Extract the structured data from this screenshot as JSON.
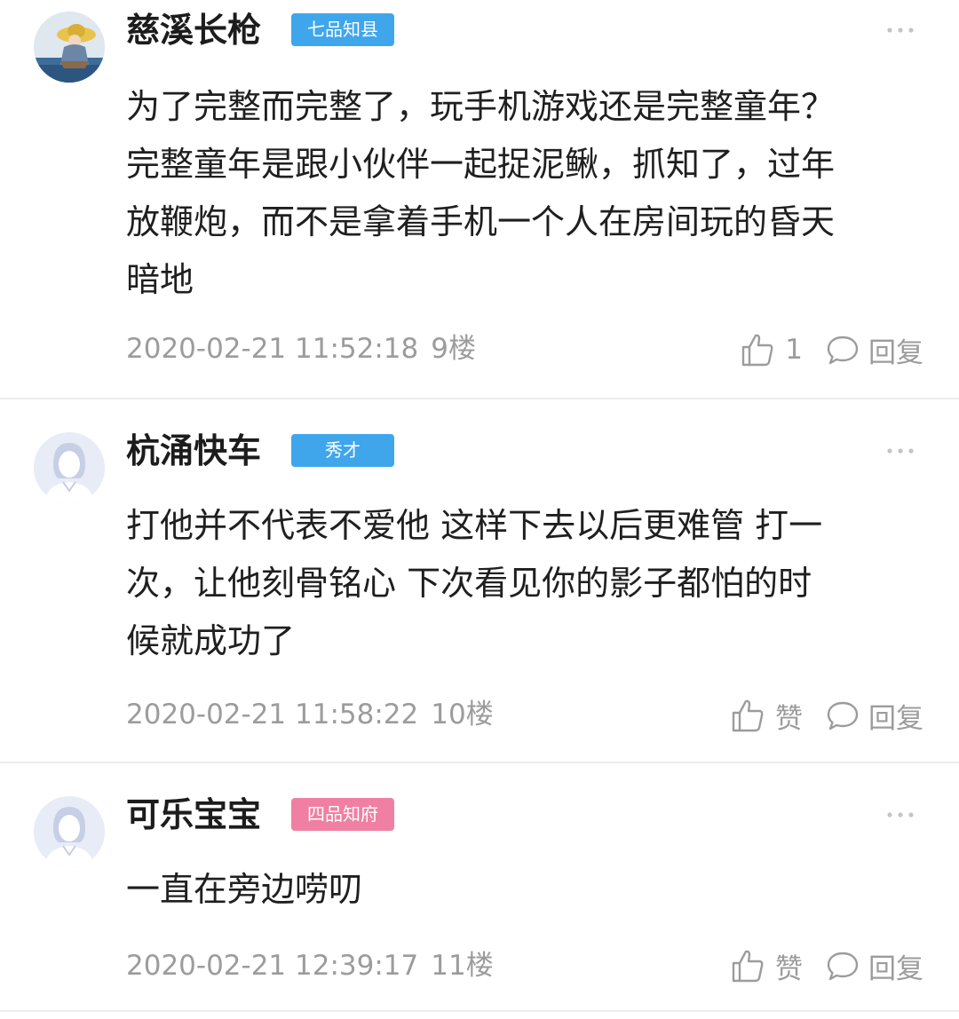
{
  "comments": [
    {
      "username": "慈溪长枪",
      "rank": "七品知县",
      "rank_color": "#3fa6ec",
      "content": "为了完整而完整了，玩手机游戏还是完整童年？\n完整童年是跟小伙伴一起捉泥鳅，抓知了，过年\n放鞭炮，而不是拿着手机一个人在房间玩的昏天\n暗地",
      "time": "2020-02-21 11:52:18",
      "floor": "9楼",
      "like_label": "1",
      "reply_label": "回复"
    },
    {
      "username": "杭涌快车",
      "rank": "秀才",
      "rank_color": "#3fa6ec",
      "content": "打他并不代表不爱他 这样下去以后更难管 打一\n次，让他刻骨铭心 下次看见你的影子都怕的时\n候就成功了",
      "time": "2020-02-21 11:58:22",
      "floor": "10楼",
      "like_label": "赞",
      "reply_label": "回复"
    },
    {
      "username": "可乐宝宝",
      "rank": "四品知府",
      "rank_color": "#f07fa4",
      "content": "一直在旁边唠叨",
      "time": "2020-02-21 12:39:17",
      "floor": "11楼",
      "like_label": "赞",
      "reply_label": "回复"
    }
  ],
  "icons": {
    "more": "more-dots-icon",
    "like": "thumbs-up-icon",
    "reply": "speech-bubble-icon"
  },
  "colors": {
    "meta_text": "#9c9c9c",
    "divider": "#ececec"
  }
}
